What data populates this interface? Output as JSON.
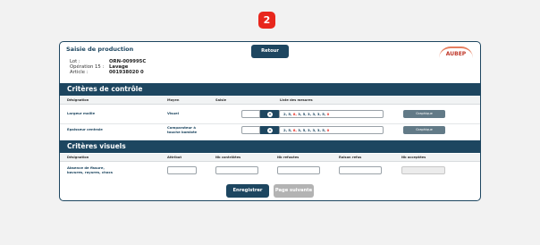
{
  "step_badge": "2",
  "page_title": "Saisie de production",
  "header": {
    "lot_label": "Lot :",
    "lot_value": "ORN-009995C",
    "operation_label": "Opération 15 :",
    "operation_value": "Lavage",
    "article_label": "Article :",
    "article_value": "001938020 0",
    "back_button": "Retour",
    "logo_text": "AUBEP"
  },
  "controle": {
    "section_title": "Critères de contrôle",
    "columns": [
      "Désignation",
      "Moyen",
      "Saisie",
      "Liste des mesures"
    ],
    "rows": [
      {
        "designation": "Largeur maille",
        "moyen": "Visuel",
        "measures": [
          "2",
          "5",
          "8",
          "3",
          "5",
          "3",
          "3",
          "3",
          "5",
          "0"
        ],
        "measures_flags": [
          false,
          false,
          true,
          false,
          false,
          false,
          false,
          false,
          false,
          true
        ],
        "graph_button": "Graphique"
      },
      {
        "designation": "Epaisseur centrale",
        "moyen_line1": "Comparateur à",
        "moyen_line2": "touche bombée",
        "measures": [
          "2",
          "5",
          "8",
          "3",
          "5",
          "3",
          "3",
          "3",
          "5",
          "0"
        ],
        "measures_flags": [
          false,
          false,
          true,
          false,
          false,
          false,
          false,
          false,
          false,
          true
        ],
        "graph_button": "Graphique"
      }
    ]
  },
  "visuels": {
    "section_title": "Critères visuels",
    "columns": [
      "Désignation",
      "Attribut",
      "Nb contrôlées",
      "Nb refusées",
      "Raison refus",
      "Nb acceptées"
    ],
    "row": {
      "designation_line1": "Absence de fissure,",
      "designation_line2": "bavures, rayures, chocs"
    }
  },
  "footer": {
    "save_button": "Enregistrer",
    "next_button": "Page suivante"
  },
  "colors": {
    "primary": "#1d4660",
    "badge": "#e8271d",
    "disabled": "#b3b3b3"
  }
}
